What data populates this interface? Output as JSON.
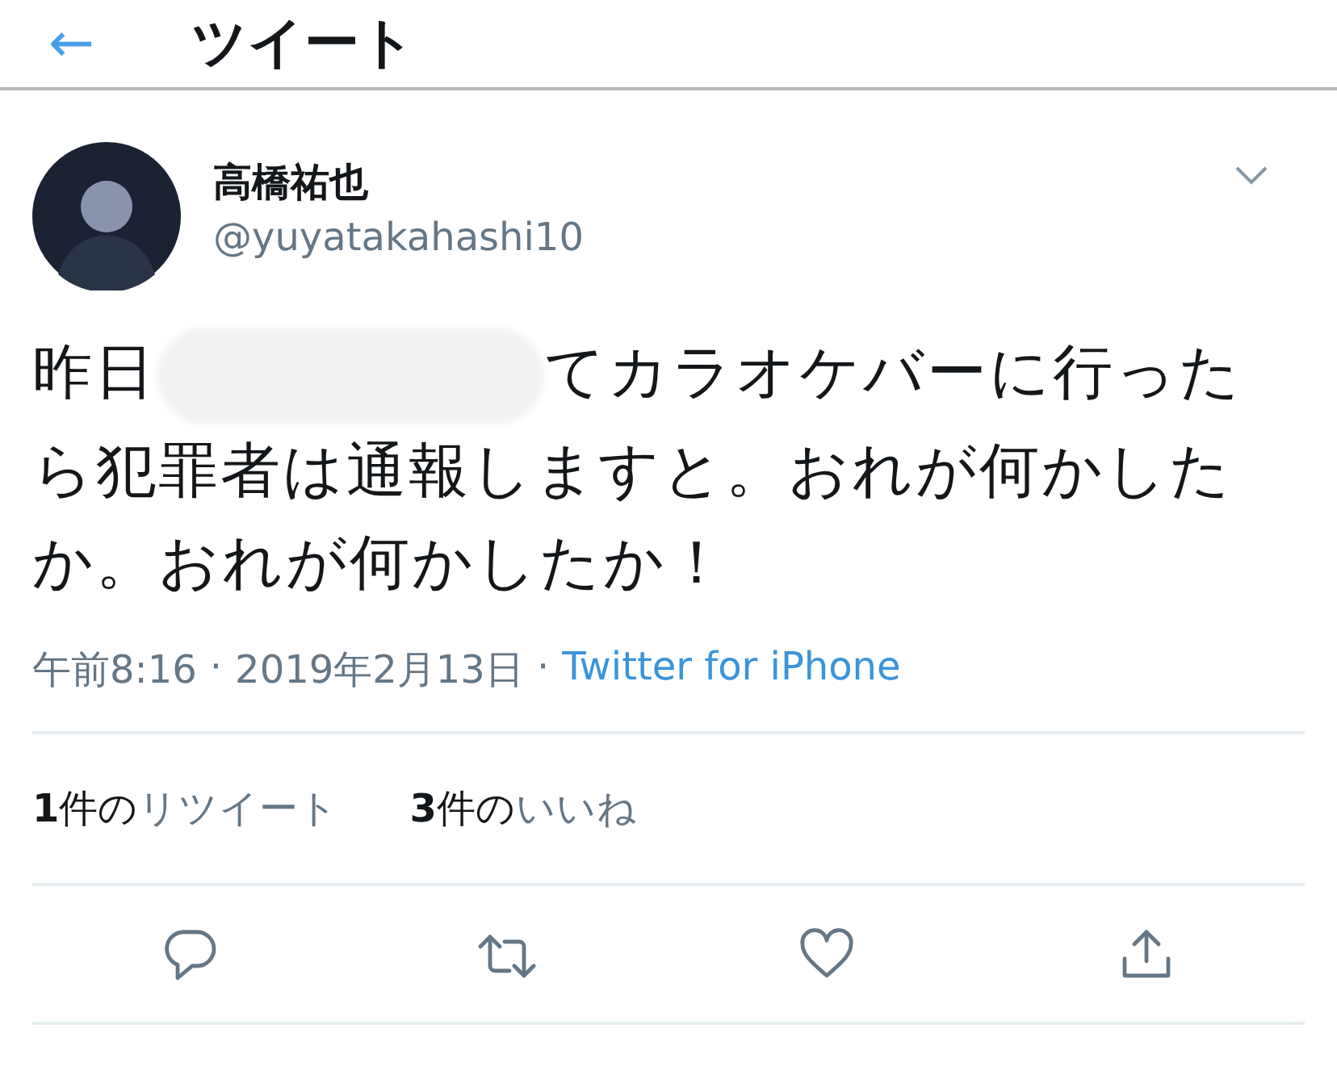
{
  "header": {
    "back": "←",
    "title": "ツイート"
  },
  "author": {
    "name": "高橋祐也",
    "handle": "@yuyatakahashi10"
  },
  "tweet": {
    "text_before": "昨日",
    "redacted": true,
    "text_after": "てカラオケバーに行ったら犯罪者は通報しますと。おれが何かしたか。おれが何かしたか！"
  },
  "meta": {
    "time": "午前8:16",
    "separator": "·",
    "date": "2019年2月13日",
    "source": "Twitter for iPhone"
  },
  "stats": [
    {
      "count": "1",
      "unit": "件の",
      "label": "リツイート"
    },
    {
      "count": "3",
      "unit": "件の",
      "label": "いいね"
    }
  ],
  "actions": [
    {
      "kind": "reply"
    },
    {
      "kind": "retweet"
    },
    {
      "kind": "like"
    },
    {
      "kind": "share"
    }
  ]
}
